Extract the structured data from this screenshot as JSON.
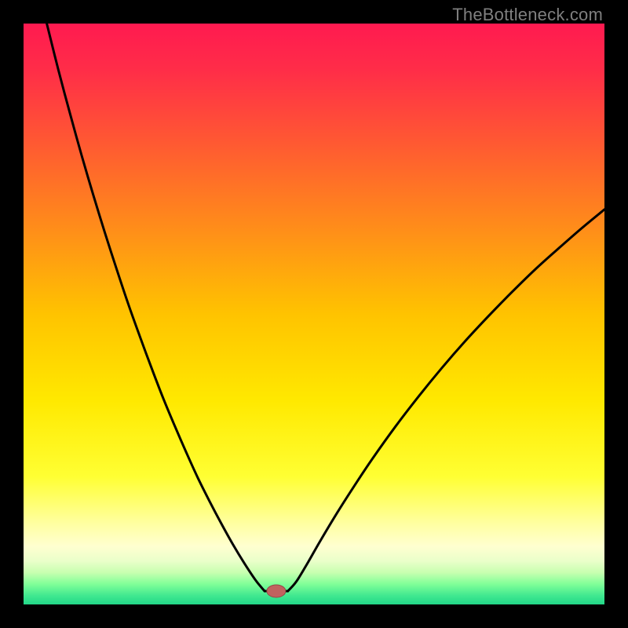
{
  "watermark": "TheBottleneck.com",
  "colors": {
    "frame": "#000000",
    "curve": "#000000",
    "marker_fill": "#c1625f",
    "marker_stroke": "#944a47",
    "gradient_stops": [
      {
        "offset": 0.0,
        "color": "#ff1a50"
      },
      {
        "offset": 0.08,
        "color": "#ff2d48"
      },
      {
        "offset": 0.2,
        "color": "#ff5733"
      },
      {
        "offset": 0.35,
        "color": "#ff8c1a"
      },
      {
        "offset": 0.5,
        "color": "#ffc300"
      },
      {
        "offset": 0.65,
        "color": "#ffe900"
      },
      {
        "offset": 0.78,
        "color": "#ffff33"
      },
      {
        "offset": 0.86,
        "color": "#ffffa0"
      },
      {
        "offset": 0.9,
        "color": "#ffffd0"
      },
      {
        "offset": 0.925,
        "color": "#eaffca"
      },
      {
        "offset": 0.945,
        "color": "#c8ffb0"
      },
      {
        "offset": 0.965,
        "color": "#80ff98"
      },
      {
        "offset": 0.985,
        "color": "#40e890"
      },
      {
        "offset": 1.0,
        "color": "#22d788"
      }
    ]
  },
  "chart_data": {
    "type": "line",
    "title": "",
    "xlabel": "",
    "ylabel": "",
    "xlim": [
      0,
      100
    ],
    "ylim": [
      0,
      100
    ],
    "grid": false,
    "series": [
      {
        "name": "bottleneck-curve-left",
        "x": [
          4,
          6,
          8,
          10,
          12,
          14,
          16,
          18,
          20,
          22,
          24,
          26,
          28,
          30,
          32,
          34,
          36,
          38,
          40,
          41.5
        ],
        "values": [
          100,
          92,
          84.5,
          77.3,
          70.5,
          64,
          57.8,
          51.8,
          46.2,
          40.8,
          35.6,
          30.8,
          26.2,
          21.8,
          17.8,
          14,
          10.4,
          7.1,
          4.1,
          2.3
        ]
      },
      {
        "name": "bottleneck-curve-right",
        "x": [
          45.5,
          47,
          49,
          51,
          54,
          57,
          60,
          64,
          68,
          72,
          76,
          80,
          84,
          88,
          92,
          96,
          100
        ],
        "values": [
          2.3,
          4.0,
          7.3,
          10.8,
          15.8,
          20.5,
          25.0,
          30.6,
          35.8,
          40.7,
          45.3,
          49.6,
          53.7,
          57.6,
          61.2,
          64.7,
          68.0
        ]
      },
      {
        "name": "bottleneck-floor",
        "x": [
          41.5,
          45.5
        ],
        "values": [
          2.3,
          2.3
        ]
      }
    ],
    "annotations": [
      {
        "name": "optimal-point-marker",
        "x": 43.5,
        "y": 2.3
      }
    ],
    "legend": null
  }
}
